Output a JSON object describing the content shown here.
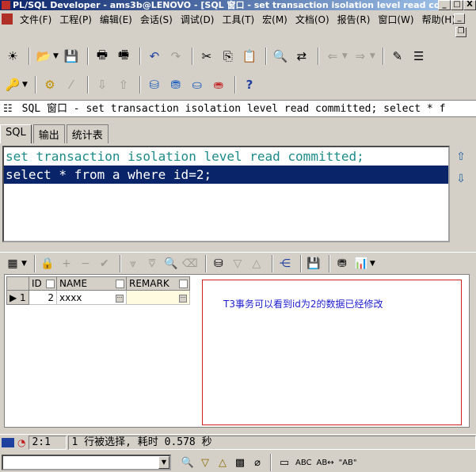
{
  "window": {
    "title": "PL/SQL Developer - ams3b@LENOVO - [SQL 窗口 - set transaction isolation level read commi...",
    "minimize": "_",
    "maximize": "□",
    "close": "X"
  },
  "menu": {
    "items": [
      "文件(F)",
      "工程(P)",
      "编辑(E)",
      "会话(S)",
      "调试(D)",
      "工具(T)",
      "宏(M)",
      "文档(O)",
      "报告(R)",
      "窗口(W)",
      "帮助(H)"
    ],
    "mdi_minimize": "_",
    "mdi_restore": "❐"
  },
  "doc_tab": {
    "text": "SQL 窗口 - set transaction isolation level read committed; select * f"
  },
  "sub_tabs": [
    "SQL",
    "输出",
    "统计表"
  ],
  "editor": {
    "lines": [
      "set transaction isolation level read committed;",
      "select * from a where id=2;"
    ]
  },
  "grid": {
    "columns": [
      "ID",
      "NAME",
      "REMARK"
    ],
    "rows": [
      {
        "row_num": "1",
        "id": "2",
        "name": "xxxx",
        "remark": ""
      }
    ]
  },
  "annotation": "T3事务可以看到id为2的数据已经修改",
  "status": {
    "position": "2:1",
    "message": "1 行被选择, 耗时 0.578 秒"
  },
  "icons": {
    "colors": {
      "accent": "#0a246a",
      "editor_keyword": "#1d8a8a",
      "note_border": "#d02020",
      "note_text": "#2020d0"
    }
  }
}
